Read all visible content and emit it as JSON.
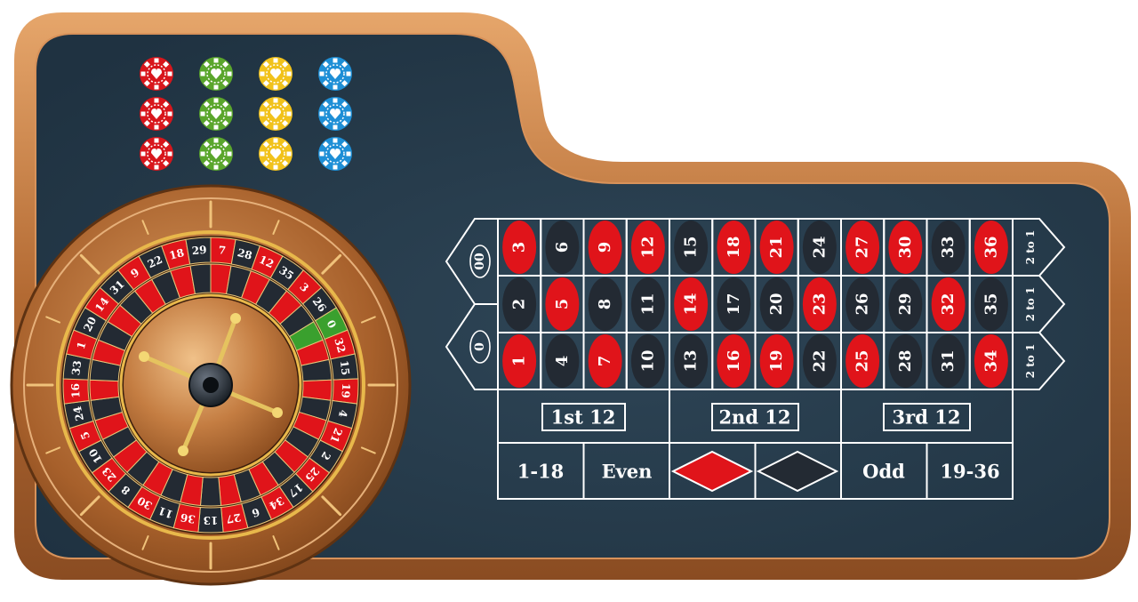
{
  "table": {
    "felt_color": "#253a4a",
    "rail_color": "#b9743c",
    "rail_highlight": "#e2a063",
    "line_color": "#ffffff",
    "red_color": "#e0141a",
    "black_color": "#232a33"
  },
  "chips": {
    "colors": [
      "#d8161c",
      "#5aa62c",
      "#f1c21b",
      "#1e8fd6"
    ],
    "rows": 3
  },
  "zeros": [
    "00",
    "0"
  ],
  "grid": {
    "columns": [
      {
        "top": "3",
        "mid": "2",
        "bot": "1"
      },
      {
        "top": "6",
        "mid": "5",
        "bot": "4"
      },
      {
        "top": "9",
        "mid": "8",
        "bot": "7"
      },
      {
        "top": "12",
        "mid": "11",
        "bot": "10"
      },
      {
        "top": "15",
        "mid": "14",
        "bot": "13"
      },
      {
        "top": "18",
        "mid": "17",
        "bot": "16"
      },
      {
        "top": "21",
        "mid": "20",
        "bot": "19"
      },
      {
        "top": "24",
        "mid": "23",
        "bot": "22"
      },
      {
        "top": "27",
        "mid": "26",
        "bot": "25"
      },
      {
        "top": "30",
        "mid": "29",
        "bot": "28"
      },
      {
        "top": "33",
        "mid": "32",
        "bot": "31"
      },
      {
        "top": "36",
        "mid": "35",
        "bot": "34"
      }
    ],
    "red_numbers": [
      "1",
      "3",
      "5",
      "7",
      "9",
      "12",
      "14",
      "16",
      "18",
      "19",
      "21",
      "23",
      "25",
      "27",
      "30",
      "32",
      "34",
      "36"
    ],
    "column_bets": [
      "2 to 1",
      "2 to 1",
      "2 to 1"
    ]
  },
  "dozens": [
    "1st 12",
    "2nd 12",
    "3rd 12"
  ],
  "outside_bets": {
    "low": "1-18",
    "even": "Even",
    "red": "red-diamond",
    "black": "black-diamond",
    "odd": "Odd",
    "high": "19-36"
  },
  "wheel": {
    "sequence": [
      "0",
      "32",
      "15",
      "19",
      "4",
      "21",
      "2",
      "25",
      "17",
      "34",
      "6",
      "27",
      "13",
      "36",
      "11",
      "30",
      "8",
      "23",
      "10",
      "5",
      "24",
      "16",
      "33",
      "1",
      "20",
      "14",
      "31",
      "9",
      "22",
      "18",
      "29",
      "7",
      "28",
      "12",
      "35",
      "3",
      "26"
    ],
    "green_color": "#3aa02e",
    "hub_icon": "wheel-turret-icon"
  }
}
